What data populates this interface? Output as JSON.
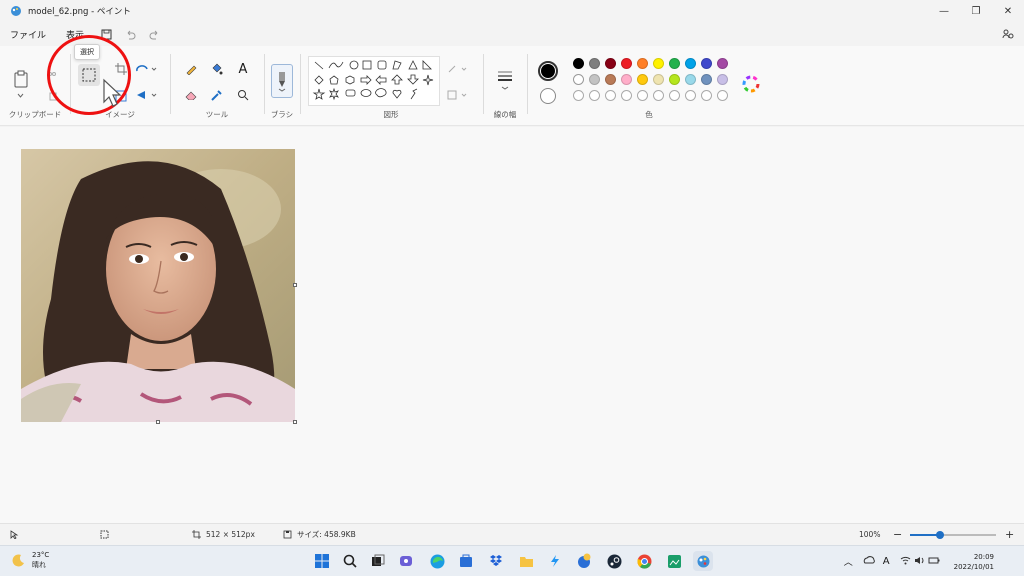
{
  "window": {
    "title": "model_62.png - ペイント",
    "minimize": "—",
    "restore": "❐",
    "close": "✕"
  },
  "menu": {
    "file": "ファイル",
    "view": "表示"
  },
  "ribbon": {
    "groups": {
      "clipboard": "クリップボード",
      "image": "イメージ",
      "tools": "ツール",
      "brush": "ブラシ",
      "shapes": "図形",
      "line_width": "線の幅",
      "colors": "色"
    },
    "tooltip": "選択",
    "primary_color": "#000000",
    "secondary_color": "#ffffff",
    "palette_row1": [
      "#000000",
      "#7f7f7f",
      "#880015",
      "#ed1c24",
      "#ff7f27",
      "#fff200",
      "#22b14c",
      "#00a2e8",
      "#3f48cc",
      "#a349a4"
    ],
    "palette_row2": [
      "#ffffff",
      "#c3c3c3",
      "#b97a57",
      "#ffaec9",
      "#ffc90e",
      "#efe4b0",
      "#b5e61d",
      "#99d9ea",
      "#7092be",
      "#c8bfe7"
    ],
    "palette_row3_count_label": "custom"
  },
  "status": {
    "dimensions": "512 × 512px",
    "size": "サイズ: 458.9KB",
    "zoom": "100%",
    "zoom_level": 0.35
  },
  "taskbar": {
    "temperature": "23°C",
    "weather": "晴れ",
    "time": "20:09",
    "date": "2022/10/01",
    "ime": "A"
  }
}
